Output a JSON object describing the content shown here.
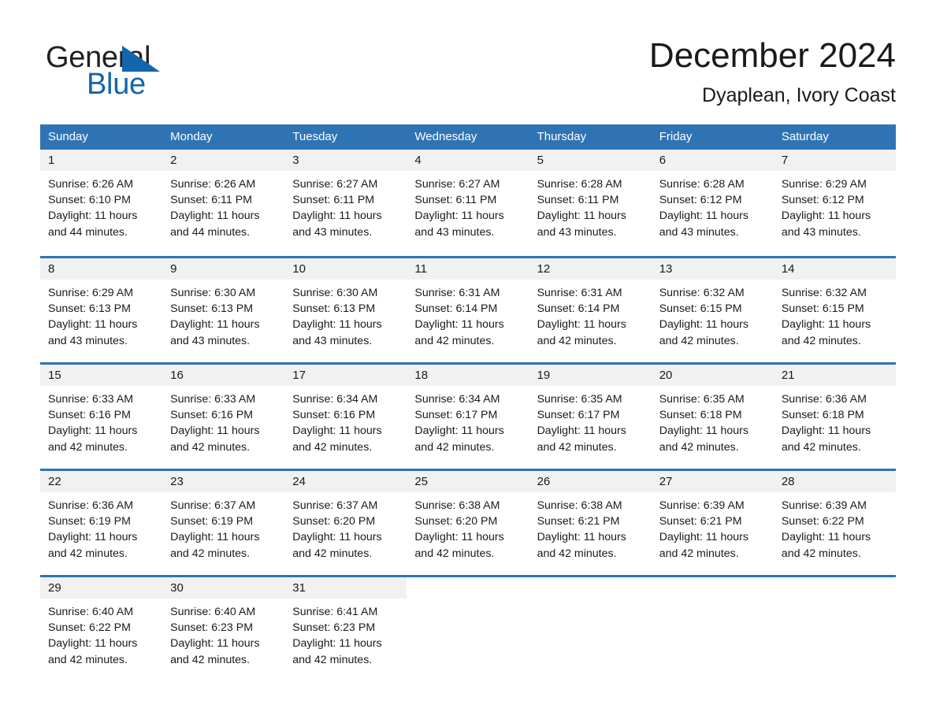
{
  "brand": {
    "name_part1": "General",
    "name_part2": "Blue",
    "triangle_icon": "triangle-icon",
    "brand_color": "#1366ac"
  },
  "header": {
    "title": "December 2024",
    "subtitle": "Dyaplean, Ivory Coast"
  },
  "theme": {
    "header_blue": "#2e74b5",
    "daynum_band": "#f1f1f1",
    "text": "#1a1a1a",
    "page_background": "#ffffff"
  },
  "calendar": {
    "weekday_headers": [
      "Sunday",
      "Monday",
      "Tuesday",
      "Wednesday",
      "Thursday",
      "Friday",
      "Saturday"
    ],
    "weeks": [
      [
        {
          "day": "1",
          "sunrise": "Sunrise: 6:26 AM",
          "sunset": "Sunset: 6:10 PM",
          "daylight": "Daylight: 11 hours and 44 minutes."
        },
        {
          "day": "2",
          "sunrise": "Sunrise: 6:26 AM",
          "sunset": "Sunset: 6:11 PM",
          "daylight": "Daylight: 11 hours and 44 minutes."
        },
        {
          "day": "3",
          "sunrise": "Sunrise: 6:27 AM",
          "sunset": "Sunset: 6:11 PM",
          "daylight": "Daylight: 11 hours and 43 minutes."
        },
        {
          "day": "4",
          "sunrise": "Sunrise: 6:27 AM",
          "sunset": "Sunset: 6:11 PM",
          "daylight": "Daylight: 11 hours and 43 minutes."
        },
        {
          "day": "5",
          "sunrise": "Sunrise: 6:28 AM",
          "sunset": "Sunset: 6:11 PM",
          "daylight": "Daylight: 11 hours and 43 minutes."
        },
        {
          "day": "6",
          "sunrise": "Sunrise: 6:28 AM",
          "sunset": "Sunset: 6:12 PM",
          "daylight": "Daylight: 11 hours and 43 minutes."
        },
        {
          "day": "7",
          "sunrise": "Sunrise: 6:29 AM",
          "sunset": "Sunset: 6:12 PM",
          "daylight": "Daylight: 11 hours and 43 minutes."
        }
      ],
      [
        {
          "day": "8",
          "sunrise": "Sunrise: 6:29 AM",
          "sunset": "Sunset: 6:13 PM",
          "daylight": "Daylight: 11 hours and 43 minutes."
        },
        {
          "day": "9",
          "sunrise": "Sunrise: 6:30 AM",
          "sunset": "Sunset: 6:13 PM",
          "daylight": "Daylight: 11 hours and 43 minutes."
        },
        {
          "day": "10",
          "sunrise": "Sunrise: 6:30 AM",
          "sunset": "Sunset: 6:13 PM",
          "daylight": "Daylight: 11 hours and 43 minutes."
        },
        {
          "day": "11",
          "sunrise": "Sunrise: 6:31 AM",
          "sunset": "Sunset: 6:14 PM",
          "daylight": "Daylight: 11 hours and 42 minutes."
        },
        {
          "day": "12",
          "sunrise": "Sunrise: 6:31 AM",
          "sunset": "Sunset: 6:14 PM",
          "daylight": "Daylight: 11 hours and 42 minutes."
        },
        {
          "day": "13",
          "sunrise": "Sunrise: 6:32 AM",
          "sunset": "Sunset: 6:15 PM",
          "daylight": "Daylight: 11 hours and 42 minutes."
        },
        {
          "day": "14",
          "sunrise": "Sunrise: 6:32 AM",
          "sunset": "Sunset: 6:15 PM",
          "daylight": "Daylight: 11 hours and 42 minutes."
        }
      ],
      [
        {
          "day": "15",
          "sunrise": "Sunrise: 6:33 AM",
          "sunset": "Sunset: 6:16 PM",
          "daylight": "Daylight: 11 hours and 42 minutes."
        },
        {
          "day": "16",
          "sunrise": "Sunrise: 6:33 AM",
          "sunset": "Sunset: 6:16 PM",
          "daylight": "Daylight: 11 hours and 42 minutes."
        },
        {
          "day": "17",
          "sunrise": "Sunrise: 6:34 AM",
          "sunset": "Sunset: 6:16 PM",
          "daylight": "Daylight: 11 hours and 42 minutes."
        },
        {
          "day": "18",
          "sunrise": "Sunrise: 6:34 AM",
          "sunset": "Sunset: 6:17 PM",
          "daylight": "Daylight: 11 hours and 42 minutes."
        },
        {
          "day": "19",
          "sunrise": "Sunrise: 6:35 AM",
          "sunset": "Sunset: 6:17 PM",
          "daylight": "Daylight: 11 hours and 42 minutes."
        },
        {
          "day": "20",
          "sunrise": "Sunrise: 6:35 AM",
          "sunset": "Sunset: 6:18 PM",
          "daylight": "Daylight: 11 hours and 42 minutes."
        },
        {
          "day": "21",
          "sunrise": "Sunrise: 6:36 AM",
          "sunset": "Sunset: 6:18 PM",
          "daylight": "Daylight: 11 hours and 42 minutes."
        }
      ],
      [
        {
          "day": "22",
          "sunrise": "Sunrise: 6:36 AM",
          "sunset": "Sunset: 6:19 PM",
          "daylight": "Daylight: 11 hours and 42 minutes."
        },
        {
          "day": "23",
          "sunrise": "Sunrise: 6:37 AM",
          "sunset": "Sunset: 6:19 PM",
          "daylight": "Daylight: 11 hours and 42 minutes."
        },
        {
          "day": "24",
          "sunrise": "Sunrise: 6:37 AM",
          "sunset": "Sunset: 6:20 PM",
          "daylight": "Daylight: 11 hours and 42 minutes."
        },
        {
          "day": "25",
          "sunrise": "Sunrise: 6:38 AM",
          "sunset": "Sunset: 6:20 PM",
          "daylight": "Daylight: 11 hours and 42 minutes."
        },
        {
          "day": "26",
          "sunrise": "Sunrise: 6:38 AM",
          "sunset": "Sunset: 6:21 PM",
          "daylight": "Daylight: 11 hours and 42 minutes."
        },
        {
          "day": "27",
          "sunrise": "Sunrise: 6:39 AM",
          "sunset": "Sunset: 6:21 PM",
          "daylight": "Daylight: 11 hours and 42 minutes."
        },
        {
          "day": "28",
          "sunrise": "Sunrise: 6:39 AM",
          "sunset": "Sunset: 6:22 PM",
          "daylight": "Daylight: 11 hours and 42 minutes."
        }
      ],
      [
        {
          "day": "29",
          "sunrise": "Sunrise: 6:40 AM",
          "sunset": "Sunset: 6:22 PM",
          "daylight": "Daylight: 11 hours and 42 minutes."
        },
        {
          "day": "30",
          "sunrise": "Sunrise: 6:40 AM",
          "sunset": "Sunset: 6:23 PM",
          "daylight": "Daylight: 11 hours and 42 minutes."
        },
        {
          "day": "31",
          "sunrise": "Sunrise: 6:41 AM",
          "sunset": "Sunset: 6:23 PM",
          "daylight": "Daylight: 11 hours and 42 minutes."
        },
        {
          "day": "",
          "sunrise": "",
          "sunset": "",
          "daylight": ""
        },
        {
          "day": "",
          "sunrise": "",
          "sunset": "",
          "daylight": ""
        },
        {
          "day": "",
          "sunrise": "",
          "sunset": "",
          "daylight": ""
        },
        {
          "day": "",
          "sunrise": "",
          "sunset": "",
          "daylight": ""
        }
      ]
    ]
  }
}
